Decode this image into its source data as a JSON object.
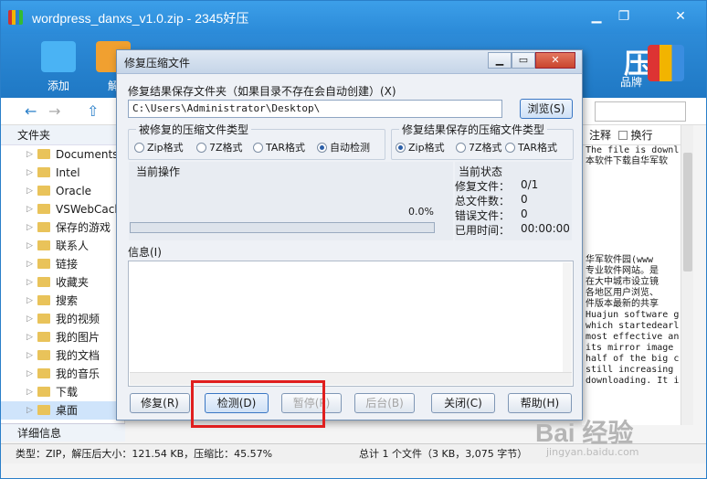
{
  "app": {
    "title": "wordpress_danxs_v1.0.zip - 2345好压",
    "toolbar": [
      {
        "label": "添加",
        "icon": "add-archive-icon",
        "color": "#4ab3f4"
      },
      {
        "label": "解",
        "icon": "extract-icon",
        "color": "#f0a030"
      }
    ],
    "brand_text": "压",
    "brand_sub": "品牌",
    "sidebar_header": "文件夹",
    "sidebar_items": [
      "Documents",
      "Intel",
      "Oracle",
      "VSWebCach",
      "保存的游戏",
      "联系人",
      "链接",
      "收藏夹",
      "搜索",
      "我的视频",
      "我的图片",
      "我的文档",
      "我的音乐",
      "下载",
      "桌面"
    ],
    "sidebar_selected": "桌面",
    "detail_header": "详细信息",
    "right_header": {
      "comment": "注释",
      "wrap": "换行"
    },
    "right_text": [
      "The file is downl",
      "本软件下载自华军软",
      "",
      "华军软件园(www",
      "专业软件网站。是",
      "在大中城市设立镜",
      "各地区用户浏览、",
      "件版本最新的共享",
      "Huajun software g",
      "which startedearl",
      "most effective an",
      "its mirror image",
      "half of the big c",
      "still increasing",
      "downloading. It i"
    ],
    "status_left": "类型：ZIP，解压后大小：121.54 KB，压缩比：45.57%",
    "status_right": "总计 1 个文件（3 KB，3,075 字节）"
  },
  "dialog": {
    "title": "修复压缩文件",
    "save_folder_label": "修复结果保存文件夹（如果目录不存在会自动创建）(X)",
    "save_path": "C:\\Users\\Administrator\\Desktop\\",
    "browse_label": "浏览(S)",
    "source_type_title": "被修复的压缩文件类型",
    "source_types": [
      {
        "label": "Zip格式",
        "checked": false
      },
      {
        "label": "7Z格式",
        "checked": false
      },
      {
        "label": "TAR格式",
        "checked": false
      },
      {
        "label": "自动检测",
        "checked": true
      }
    ],
    "target_type_title": "修复结果保存的压缩文件类型",
    "target_types": [
      {
        "label": "Zip格式",
        "checked": true
      },
      {
        "label": "7Z格式",
        "checked": false
      },
      {
        "label": "TAR格式",
        "checked": false
      }
    ],
    "current_op_title": "当前操作",
    "progress_percent": 0,
    "progress_text": "0.0%",
    "status_title": "当前状态",
    "status_rows": [
      {
        "key": "修复文件：",
        "value": "0/1"
      },
      {
        "key": "总文件数：",
        "value": "0"
      },
      {
        "key": "错误文件：",
        "value": "0"
      },
      {
        "key": "已用时间：",
        "value": "00:00:00"
      }
    ],
    "info_label": "信息(I)",
    "buttons": {
      "repair": "修复(R)",
      "detect": "检测(D)",
      "pause": "暂停(P)",
      "background": "后台(B)",
      "close": "关闭(C)",
      "help": "帮助(H)"
    }
  },
  "watermark": {
    "text": "Bai 经验",
    "sub": "jingyan.baidu.com"
  },
  "highlight_color": "#e01f1f"
}
